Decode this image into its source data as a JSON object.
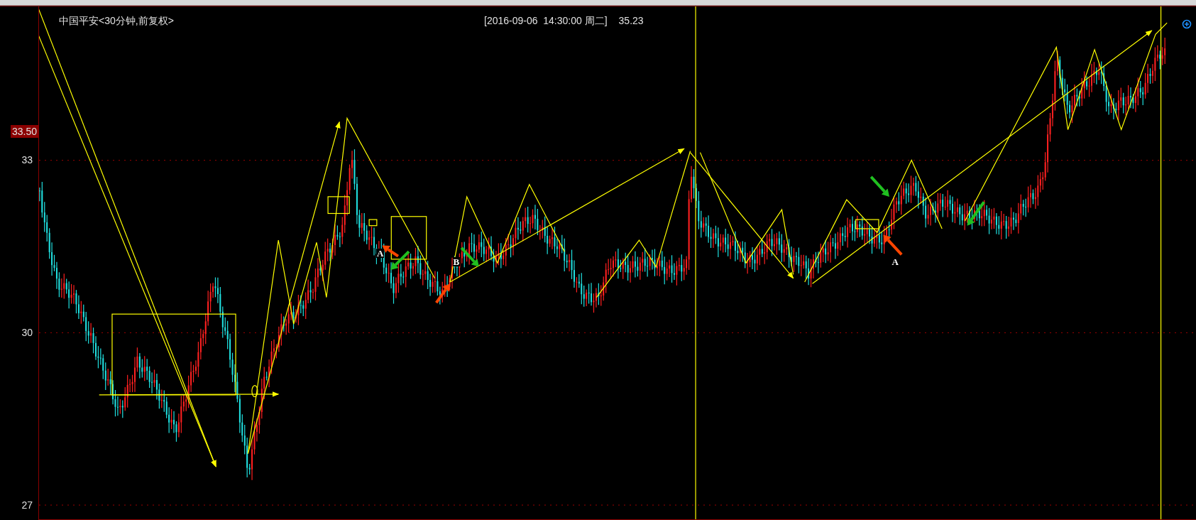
{
  "chart_header": {
    "title": "中国平安<30分钟,前复权>",
    "timestamp": "[2016-09-06  14:30:00 周二]",
    "value": "35.23"
  },
  "price_axis": {
    "ticks": [
      "33",
      "30",
      "27"
    ],
    "current_price": "33.50"
  },
  "annotations": [
    {
      "label": "A"
    },
    {
      "label": "B"
    },
    {
      "label": "A"
    }
  ]
}
